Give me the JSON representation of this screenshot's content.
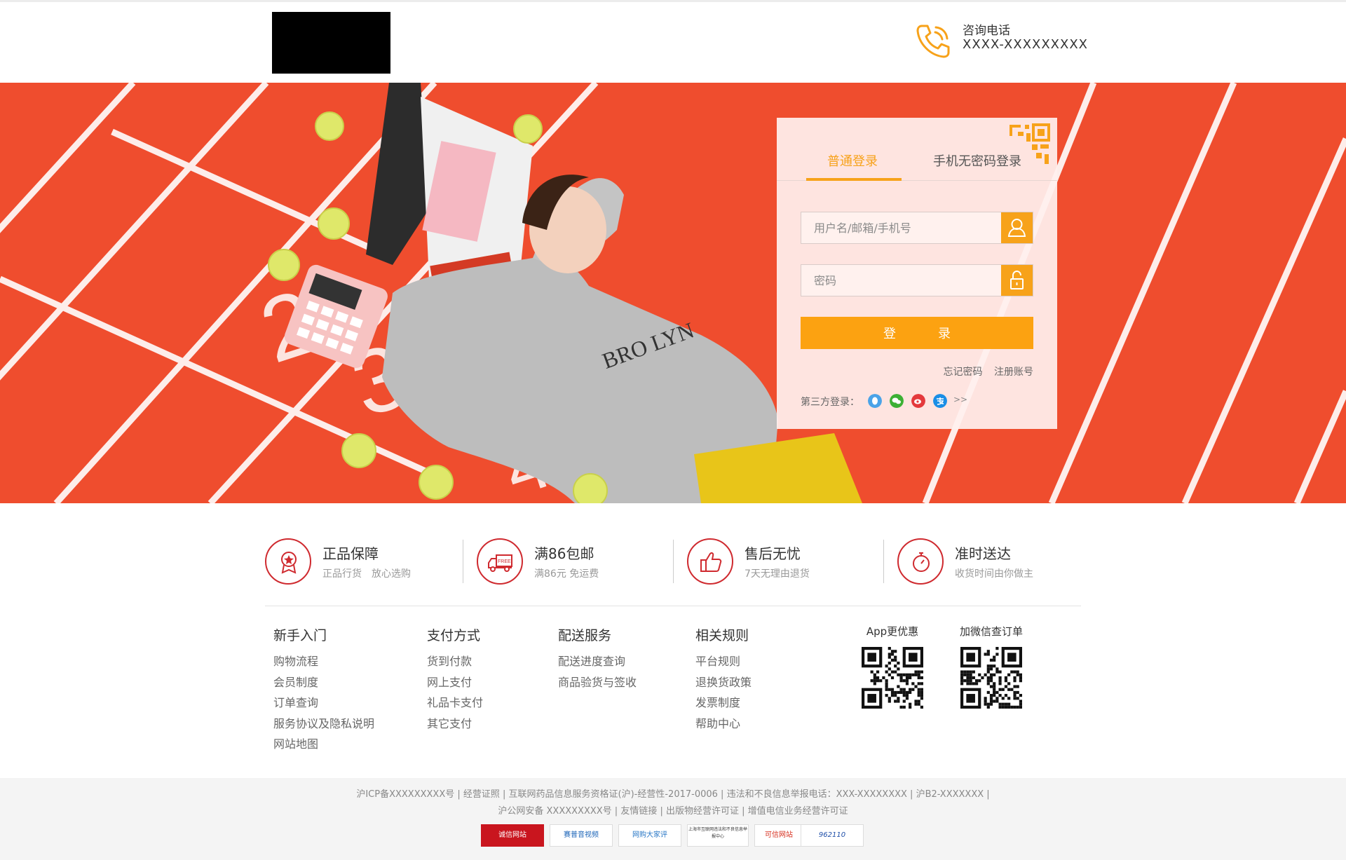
{
  "header": {
    "hotline_label": "咨询电话",
    "hotline_number": "XXXX-XXXXXXXXX"
  },
  "colors": {
    "accent": "#fca211",
    "brand_red": "#cf2a2f",
    "banner_red": "#ee4a2c"
  },
  "login": {
    "tab_normal": "普通登录",
    "tab_phone": "手机无密码登录",
    "username_placeholder": "用户名/邮箱/手机号",
    "password_placeholder": "密码",
    "submit_label": "登录",
    "forgot_password": "忘记密码",
    "register": "注册账号",
    "third_party_label": "第三方登录：",
    "third_party_icons": [
      "qq-icon",
      "wechat-icon",
      "weibo-icon",
      "alipay-icon"
    ],
    "more": ">>"
  },
  "services": [
    {
      "title": "正品保障",
      "subtitle": "正品行货　放心选购",
      "icon": "medal-icon"
    },
    {
      "title": "满86包邮",
      "subtitle": "满86元 免运费",
      "icon": "free-shipping-truck-icon"
    },
    {
      "title": "售后无忧",
      "subtitle": "7天无理由退货",
      "icon": "thumbs-up-icon"
    },
    {
      "title": "准时送达",
      "subtitle": "收货时间由你做主",
      "icon": "stopwatch-icon"
    }
  ],
  "footer": {
    "columns": [
      {
        "heading": "新手入门",
        "links": [
          "购物流程",
          "会员制度",
          "订单查询",
          "服务协议及隐私说明",
          "网站地图"
        ]
      },
      {
        "heading": "支付方式",
        "links": [
          "货到付款",
          "网上支付",
          "礼品卡支付",
          "其它支付"
        ]
      },
      {
        "heading": "配送服务",
        "links": [
          "配送进度查询",
          "商品验货与签收"
        ]
      },
      {
        "heading": "相关规则",
        "links": [
          "平台规则",
          "退换货政策",
          "发票制度",
          "帮助中心"
        ]
      }
    ],
    "qr_app_title": "App更优惠",
    "qr_wechat_title": "加微信查订单"
  },
  "bottom": {
    "license_line_1": "沪ICP备XXXXXXXXX号 | 经营证照 | 互联网药品信息服务资格证(沪)-经营性-2017-0006 | 违法和不良信息举报电话：XXX-XXXXXXXX | 沪B2-XXXXXXX |",
    "license_line_2": "沪公网安备 XXXXXXXXX号 | 友情链接 | 出版物经营许可证 | 增值电信业务经营许可证",
    "badges": [
      "诚信网站",
      "赛普音视频",
      "网购大家评",
      "上海市互联网违法和不良信息举报中心",
      "可信网站",
      "962110"
    ]
  }
}
